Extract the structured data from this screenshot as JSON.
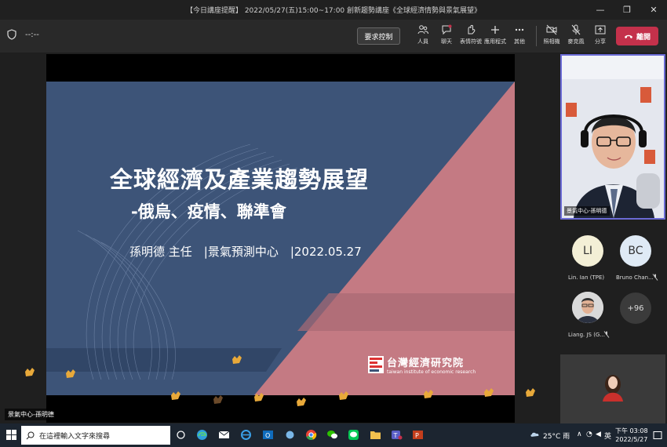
{
  "window": {
    "title": "【今日講座提醒】 2022/05/27(五)15:00~17:00 創新趨勢講座《全球經濟情勢與景氣展望》"
  },
  "toolbar": {
    "timer": "--:--",
    "request_control": "要求控制",
    "buttons": [
      {
        "label": "人員",
        "icon": "people-icon"
      },
      {
        "label": "聊天",
        "icon": "chat-icon"
      },
      {
        "label": "表情符號",
        "icon": "reaction-icon"
      },
      {
        "label": "應用程式",
        "icon": "add-apps-icon"
      },
      {
        "label": "其他",
        "icon": "more-icon"
      },
      {
        "label": "照相機",
        "icon": "camera-off-icon"
      },
      {
        "label": "麥克風",
        "icon": "mic-off-icon"
      },
      {
        "label": "分享",
        "icon": "share-icon"
      }
    ],
    "leave": "離開"
  },
  "slide": {
    "title": "全球經濟及產業趨勢展望",
    "subtitle": "-俄烏、疫情、聯準會",
    "author": "孫明德 主任　|景氣預測中心　|2022.05.27",
    "logo_cn": "台灣經濟研究院",
    "logo_en": "taiwan institute of economic research"
  },
  "presenter_label": "景氣中心-孫明德",
  "participants": {
    "video_name": "景氣中心-孫明德",
    "list": [
      {
        "initials": "LI",
        "name": "Lin. Ian (TPE)"
      },
      {
        "initials": "BC",
        "name": "Bruno Chan..."
      },
      {
        "initials": "",
        "name": "Liang. JS (G..."
      }
    ],
    "more": "+96"
  },
  "taskbar": {
    "search_placeholder": "在這裡輸入文字來搜尋",
    "weather": "25°C 雨",
    "ime": "英",
    "time_line1": "下午 03:08",
    "time_line2": "2022/5/27"
  },
  "colors": {
    "slide_blue": "#3d5478",
    "slide_pink": "#c47a83",
    "leave_red": "#c4314b",
    "accent_border": "#6b6bd6"
  }
}
